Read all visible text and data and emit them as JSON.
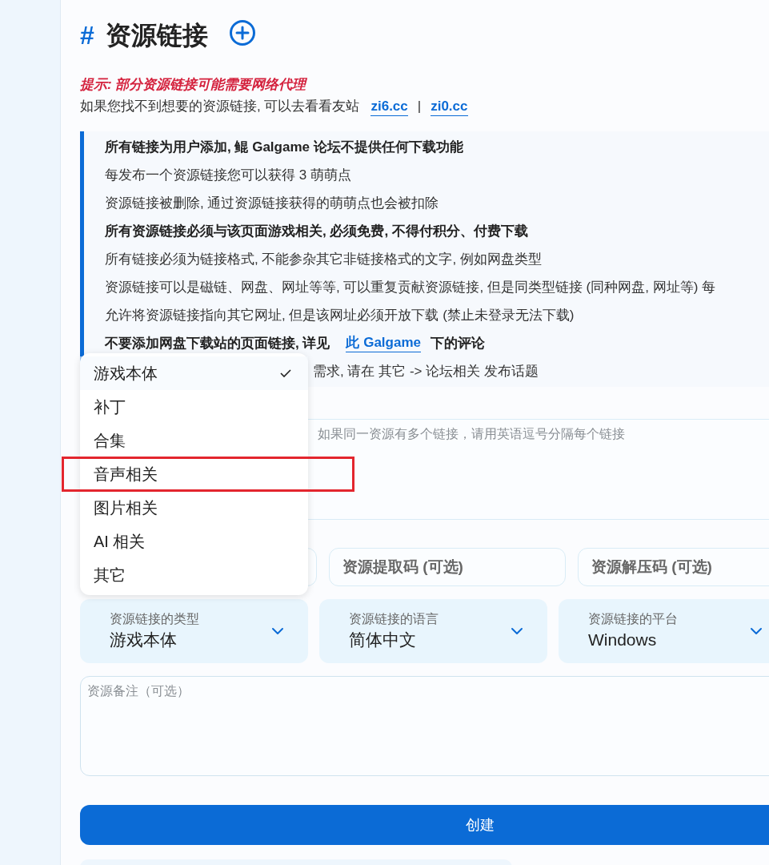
{
  "heading": {
    "hash": "#",
    "text": "资源链接"
  },
  "tip": "提示: 部分资源链接可能需要网络代理",
  "friend_sites": {
    "text": "如果您找不到想要的资源链接, 可以去看看友站",
    "links": [
      "zi6.cc",
      "zi0.cc"
    ],
    "separator": "|"
  },
  "notices": [
    {
      "kind": "plain",
      "bold": true,
      "text": "所有链接为用户添加, 鲲 Galgame 论坛不提供任何下载功能"
    },
    {
      "kind": "plain",
      "bold": false,
      "text": "每发布一个资源链接您可以获得 3 萌萌点"
    },
    {
      "kind": "plain",
      "bold": false,
      "text": "资源链接被删除, 通过资源链接获得的萌萌点也会被扣除"
    },
    {
      "kind": "plain",
      "bold": true,
      "text": "所有资源链接必须与该页面游戏相关, 必须免费, 不得付积分、付费下载"
    },
    {
      "kind": "plain",
      "bold": false,
      "text": "所有链接必须为链接格式, 不能参杂其它非链接格式的文字, 例如网盘类型"
    },
    {
      "kind": "plain",
      "bold": false,
      "text": "资源链接可以是磁链、网盘、网址等等, 可以重复贡献资源链接, 但是同类型链接 (同种网盘, 网址等) 每"
    },
    {
      "kind": "plain",
      "bold": false,
      "text": "允许将资源链接指向其它网址, 但是该网址必须开放下载 (禁止未登录无法下载)"
    },
    {
      "kind": "link",
      "bold": true,
      "before": "不要添加网盘下载站的页面链接, 详见",
      "link": "此 Galgame",
      "after": "下的评论"
    },
    {
      "kind": "covered",
      "bold": false,
      "text": "需求, 请在 其它 -> 论坛相关 发布话题"
    }
  ],
  "link_field": {
    "placeholder": "如果同一资源有多个链接，请用英语逗号分隔每个链接"
  },
  "fields": [
    {
      "placeholder": "资源提取码 (可选)"
    },
    {
      "placeholder": "资源解压码 (可选)"
    }
  ],
  "selects": [
    {
      "label": "资源链接的类型",
      "value": "游戏本体"
    },
    {
      "label": "资源链接的语言",
      "value": "简体中文"
    },
    {
      "label": "资源链接的平台",
      "value": "Windows"
    }
  ],
  "note_field": {
    "placeholder": "资源备注（可选）"
  },
  "submit": "创建",
  "type_dropdown": {
    "options": [
      {
        "label": "游戏本体",
        "selected": true,
        "highlighted": false
      },
      {
        "label": "补丁",
        "selected": false,
        "highlighted": false
      },
      {
        "label": "合集",
        "selected": false,
        "highlighted": false
      },
      {
        "label": "音声相关",
        "selected": false,
        "highlighted": true
      },
      {
        "label": "图片相关",
        "selected": false,
        "highlighted": false
      },
      {
        "label": "AI 相关",
        "selected": false,
        "highlighted": false
      },
      {
        "label": "其它",
        "selected": false,
        "highlighted": false
      }
    ]
  }
}
